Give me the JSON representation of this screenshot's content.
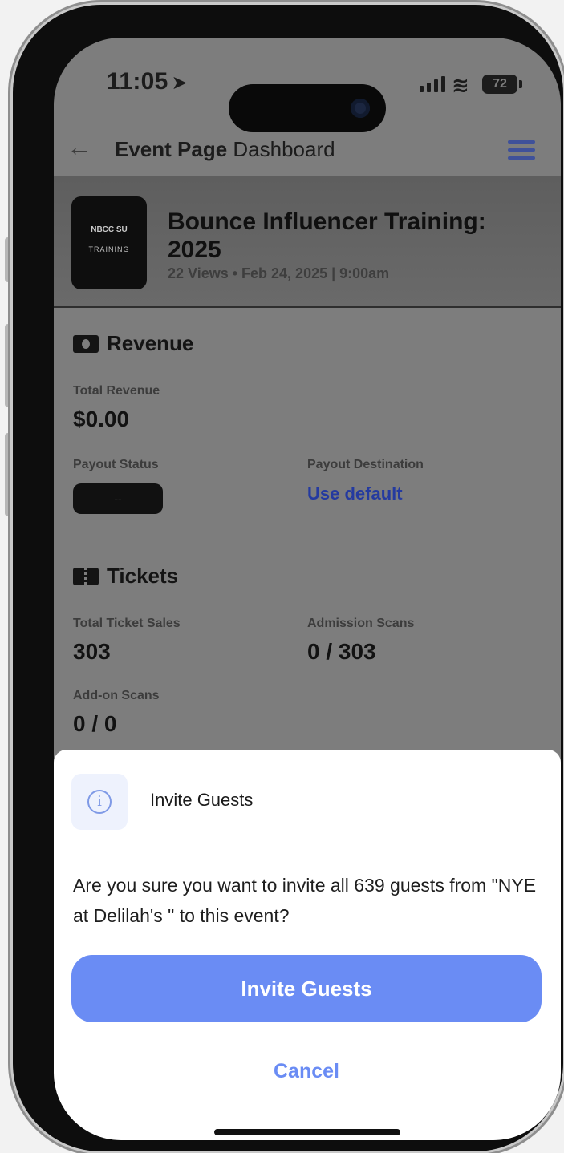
{
  "status_bar": {
    "time": "11:05",
    "battery": "72"
  },
  "nav": {
    "title_bold": "Event Page",
    "title_rest": " Dashboard"
  },
  "event": {
    "thumb_logo": "NBCC SU",
    "thumb_sub": "TRAINING",
    "title": "Bounce Influencer Training: 2025",
    "meta": "22 Views • Feb 24, 2025 | 9:00am"
  },
  "revenue": {
    "heading": "Revenue",
    "total_label": "Total Revenue",
    "total_value": "$0.00",
    "payout_status_label": "Payout Status",
    "payout_status_value": "--",
    "payout_dest_label": "Payout Destination",
    "payout_dest_link": "Use default"
  },
  "tickets": {
    "heading": "Tickets",
    "sales_label": "Total Ticket Sales",
    "sales_value": "303",
    "admission_label": "Admission Scans",
    "admission_value": "0 / 303",
    "addon_label": "Add-on Scans",
    "addon_value": "0 / 0"
  },
  "dialog": {
    "title": "Invite Guests",
    "message": "Are you sure you want to invite all 639 guests from \"NYE at Delilah's \" to this event?",
    "confirm_label": "Invite Guests",
    "cancel_label": "Cancel"
  },
  "colors": {
    "accent": "#6a8cf4",
    "link": "#243aa0",
    "overlay": "#7d7d7d",
    "sheet_bg": "#ffffff"
  }
}
